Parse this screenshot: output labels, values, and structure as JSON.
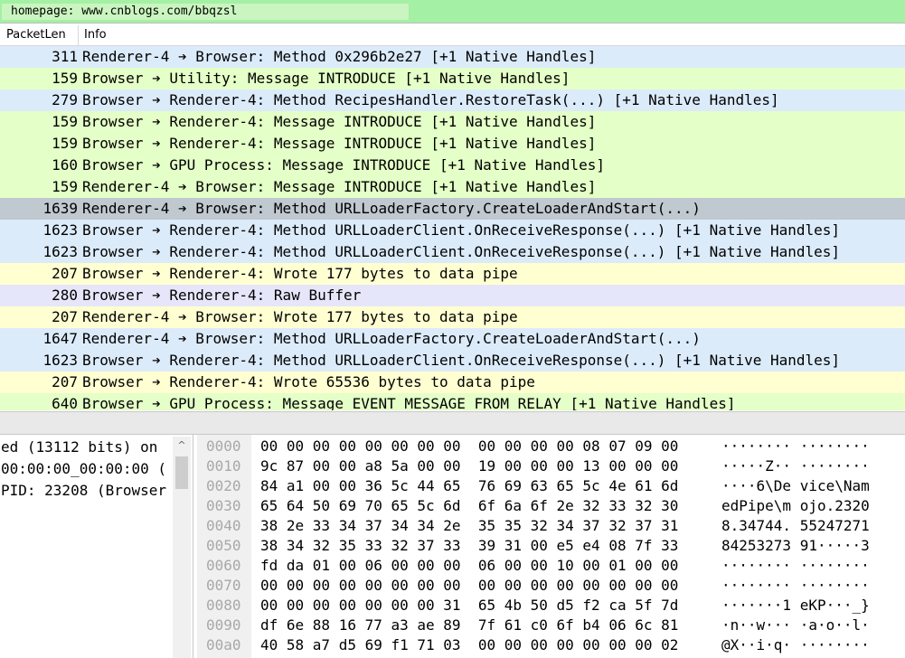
{
  "filter": {
    "text": "homepage: www.cnblogs.com/bbqzsl"
  },
  "columns": {
    "len": "PacketLen",
    "info": "Info"
  },
  "packets": [
    {
      "len": "311",
      "info": "Renderer-4 ➔ Browser: Method 0x296b2e27 [+1 Native Handles]",
      "bg": "#dcebfa"
    },
    {
      "len": "159",
      "info": "Browser ➔ Utility: Message INTRODUCE [+1 Native Handles]",
      "bg": "#e4ffc7"
    },
    {
      "len": "279",
      "info": "Browser ➔ Renderer-4: Method RecipesHandler.RestoreTask(...) [+1 Native Handles]",
      "bg": "#dcebfa"
    },
    {
      "len": "159",
      "info": "Browser ➔ Renderer-4: Message INTRODUCE [+1 Native Handles]",
      "bg": "#e4ffc7"
    },
    {
      "len": "159",
      "info": "Browser ➔ Renderer-4: Message INTRODUCE [+1 Native Handles]",
      "bg": "#e4ffc7"
    },
    {
      "len": "160",
      "info": "Browser ➔ GPU Process: Message INTRODUCE [+1 Native Handles]",
      "bg": "#e4ffc7"
    },
    {
      "len": "159",
      "info": "Renderer-4 ➔ Browser: Message INTRODUCE [+1 Native Handles]",
      "bg": "#e4ffc7"
    },
    {
      "len": "1639",
      "info": "Renderer-4 ➔ Browser: Method URLLoaderFactory.CreateLoaderAndStart(...)",
      "bg": "#c0c8d0"
    },
    {
      "len": "1623",
      "info": "Browser ➔ Renderer-4: Method URLLoaderClient.OnReceiveResponse(...) [+1 Native Handles]",
      "bg": "#dcebfa"
    },
    {
      "len": "1623",
      "info": "Browser ➔ Renderer-4: Method URLLoaderClient.OnReceiveResponse(...) [+1 Native Handles]",
      "bg": "#dcebfa"
    },
    {
      "len": "207",
      "info": "Browser ➔ Renderer-4: Wrote 177 bytes to data pipe",
      "bg": "#ffffd2"
    },
    {
      "len": "280",
      "info": "Browser ➔ Renderer-4: Raw Buffer",
      "bg": "#e6e6fa"
    },
    {
      "len": "207",
      "info": "Renderer-4 ➔ Browser: Wrote 177 bytes to data pipe",
      "bg": "#ffffd2"
    },
    {
      "len": "1647",
      "info": "Renderer-4 ➔ Browser: Method URLLoaderFactory.CreateLoaderAndStart(...)",
      "bg": "#dcebfa"
    },
    {
      "len": "1623",
      "info": "Browser ➔ Renderer-4: Method URLLoaderClient.OnReceiveResponse(...) [+1 Native Handles]",
      "bg": "#dcebfa"
    },
    {
      "len": "207",
      "info": "Browser ➔ Renderer-4: Wrote 65536 bytes to data pipe",
      "bg": "#ffffd2"
    },
    {
      "len": "640",
      "info": "Browser ➔ GPU Process: Message EVENT_MESSAGE_FROM_RELAY [+1 Native Handles]",
      "bg": "#e4ffc7"
    }
  ],
  "details": [
    "ed (13112 bits) on",
    "00:00:00_00:00:00 (",
    "PID: 23208 (Browser"
  ],
  "scrollbar": {
    "up_arrow": "^"
  },
  "hex_rows": [
    {
      "offset": "0000",
      "hex": "00 00 00 00 00 00 00 00  00 00 00 00 08 07 09 00",
      "ascii": "········ ········"
    },
    {
      "offset": "0010",
      "hex": "9c 87 00 00 a8 5a 00 00  19 00 00 00 13 00 00 00",
      "ascii": "·····Z·· ········"
    },
    {
      "offset": "0020",
      "hex": "84 a1 00 00 36 5c 44 65  76 69 63 65 5c 4e 61 6d",
      "ascii": "····6\\De vice\\Nam"
    },
    {
      "offset": "0030",
      "hex": "65 64 50 69 70 65 5c 6d  6f 6a 6f 2e 32 33 32 30",
      "ascii": "edPipe\\m ojo.2320"
    },
    {
      "offset": "0040",
      "hex": "38 2e 33 34 37 34 34 2e  35 35 32 34 37 32 37 31",
      "ascii": "8.34744. 55247271"
    },
    {
      "offset": "0050",
      "hex": "38 34 32 35 33 32 37 33  39 31 00 e5 e4 08 7f 33",
      "ascii": "84253273 91·····3"
    },
    {
      "offset": "0060",
      "hex": "fd da 01 00 06 00 00 00  06 00 00 10 00 01 00 00",
      "ascii": "········ ········"
    },
    {
      "offset": "0070",
      "hex": "00 00 00 00 00 00 00 00  00 00 00 00 00 00 00 00",
      "ascii": "········ ········"
    },
    {
      "offset": "0080",
      "hex": "00 00 00 00 00 00 00 31  65 4b 50 d5 f2 ca 5f 7d",
      "ascii": "·······1 eKP···_}"
    },
    {
      "offset": "0090",
      "hex": "df 6e 88 16 77 a3 ae 89  7f 61 c0 6f b4 06 6c 81",
      "ascii": "·n··w··· ·a·o··l·"
    },
    {
      "offset": "00a0",
      "hex": "40 58 a7 d5 69 f1 71 03  00 00 00 00 00 00 00 02",
      "ascii": "@X··i·q· ········"
    }
  ]
}
